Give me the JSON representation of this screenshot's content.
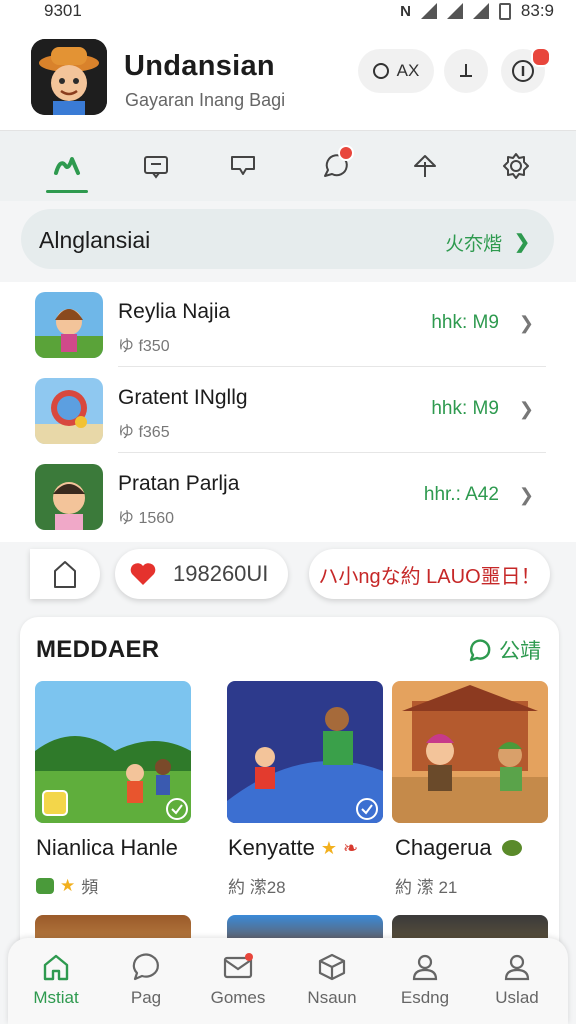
{
  "status_bar": {
    "time": "9301",
    "right": "83:9",
    "icons": [
      "nfc-icon",
      "wifi-icon",
      "signal-icon",
      "signal-icon",
      "battery-icon"
    ]
  },
  "header": {
    "title": "Undansian",
    "subtitle": "Gayaran Inang Bagi",
    "pill_label": "AX",
    "buttons": [
      "pill-button",
      "pin-button",
      "info-button"
    ]
  },
  "icon_tabs": [
    "app-logo-icon",
    "inbox-icon",
    "message-icon",
    "chat-bubble-icon",
    "upload-arrow-icon",
    "settings-gear-icon"
  ],
  "section": {
    "label": "Alnglansiai",
    "link": "火夵煯"
  },
  "list": [
    {
      "name": "Reylia Najia",
      "meta": "ゆ f350",
      "right": "hhk: M9"
    },
    {
      "name": "Gratent INgllg",
      "meta": "ゆ f365",
      "right": "hhk: M9"
    },
    {
      "name": "Pratan Parlja",
      "meta": "ゆ 1560",
      "right": "hhr.: A42"
    }
  ],
  "chips": {
    "likes": "198260UI",
    "promo": "ハ小ngな約 LAUO噩日！"
  },
  "card": {
    "title": "MEDDAER",
    "more": "公靖",
    "tiles": [
      {
        "name": "Nianlica Hanle",
        "meta": "頻"
      },
      {
        "name": "Kenyatte",
        "meta": "約 潆28"
      },
      {
        "name": "Chagerua",
        "meta": "約 潆 21"
      }
    ]
  },
  "bottom_nav": [
    {
      "label": "Mstiat",
      "active": true
    },
    {
      "label": "Pag"
    },
    {
      "label": "Gomes"
    },
    {
      "label": "Nsaun"
    },
    {
      "label": "Esdng"
    },
    {
      "label": "Uslad"
    }
  ],
  "colors": {
    "accent": "#2e9a4f",
    "badge": "#e8463c"
  }
}
